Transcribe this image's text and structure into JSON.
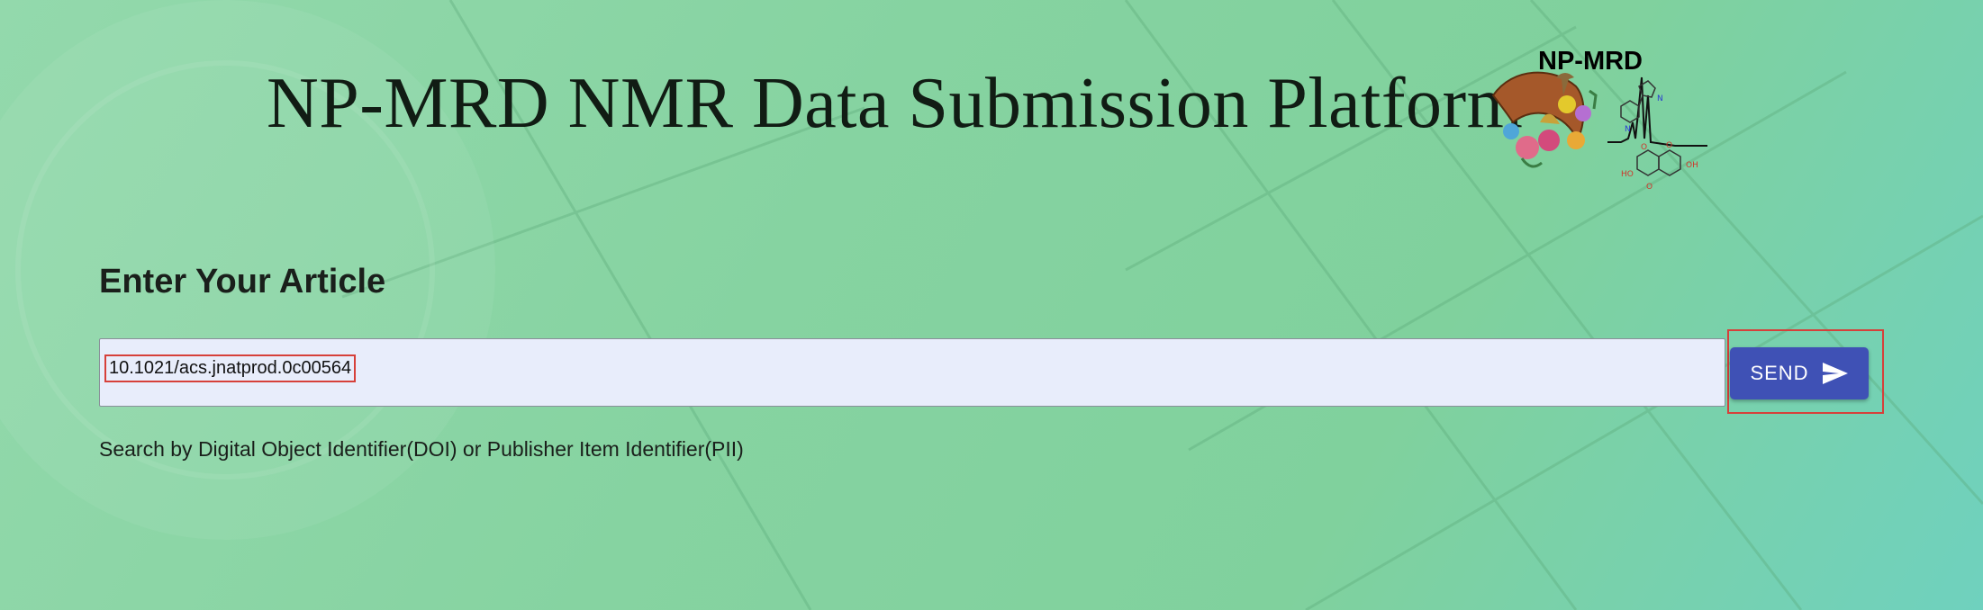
{
  "header": {
    "title": "NP-MRD NMR Data Submission Platform",
    "logo_text": "NP-MRD"
  },
  "form": {
    "heading": "Enter Your Article",
    "input_value": "10.1021/acs.jnatprod.0c00564",
    "send_label": "SEND",
    "helper_text": "Search by Digital Object Identifier(DOI) or Publisher Item Identifier(PII)"
  },
  "colors": {
    "background": "#86d3a1",
    "input_background": "#e8edfb",
    "button": "#3f51b5",
    "highlight_outline": "#d6403a"
  },
  "icons": {
    "send": "send-icon",
    "logo": "np-mrd-logo"
  }
}
